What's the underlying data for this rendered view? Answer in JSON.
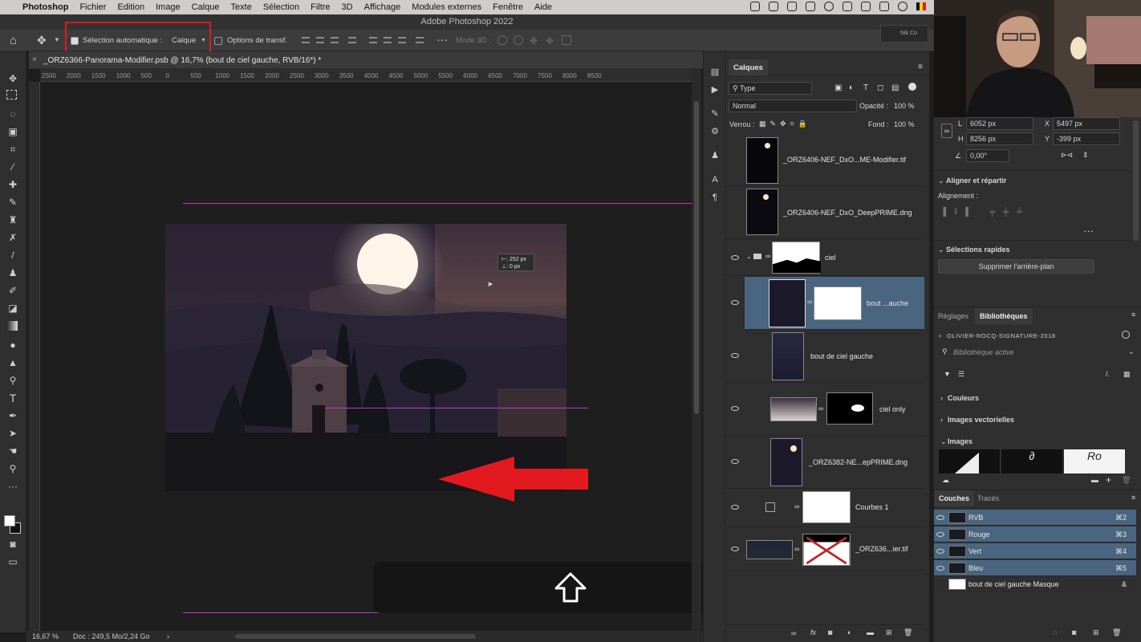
{
  "menubar": {
    "app_name": "Photoshop",
    "items": [
      "Fichier",
      "Edition",
      "Image",
      "Calque",
      "Texte",
      "Sélection",
      "Filtre",
      "3D",
      "Affichage",
      "Modules externes",
      "Fenêtre",
      "Aide"
    ]
  },
  "window": {
    "title": "Adobe Photoshop 2022"
  },
  "options": {
    "auto_select_label": "Sélection automatique :",
    "auto_select_value": "Calque",
    "transform_options_label": "Options de transf.",
    "mode3d_label": "Mode 3D :",
    "nik_label": "Nik Co"
  },
  "document": {
    "tab_title": "_ORZ6366-Panorama-Modifier.psb @ 16,7% (bout de ciel gauche, RVB/16*) *",
    "zoom": "16,67 %",
    "doc_info": "Doc : 249,5 Mo/2,24 Go",
    "ruler_labels": [
      "2500",
      "2000",
      "1500",
      "1000",
      "500",
      "0",
      "500",
      "1000",
      "1500",
      "2000",
      "2500",
      "3000",
      "3500",
      "4000",
      "4500",
      "5000",
      "5500",
      "6000",
      "6500",
      "7000",
      "7500",
      "8000",
      "8500"
    ],
    "move_tooltip": {
      "dx": "252 px",
      "dy": "0 px"
    }
  },
  "layers_panel": {
    "tab": "Calques",
    "filter_kind": "Type",
    "blend_mode": "Normal",
    "opacity_label": "Opacité :",
    "opacity_value": "100 %",
    "lock_label": "Verrou :",
    "fill_label": "Fond :",
    "fill_value": "100 %",
    "layers": [
      {
        "name": "_ORZ6406-NEF_DxO...ME-Modifier.tif",
        "visible": false
      },
      {
        "name": "_ORZ6406-NEF_DxO_DeepPRIME.dng",
        "visible": false
      },
      {
        "name": "ciel",
        "visible": true
      },
      {
        "name": "bout ...auche",
        "visible": true
      },
      {
        "name": "bout de ciel gauche",
        "visible": true
      },
      {
        "name": "ciel only",
        "visible": true
      },
      {
        "name": "_ORZ6382-NE...epPRIME.dng",
        "visible": true
      },
      {
        "name": "Courbes 1",
        "visible": true
      },
      {
        "name": "_ORZ636...ier.tif",
        "visible": true
      }
    ]
  },
  "properties": {
    "w_label": "L",
    "w_value": "6052 px",
    "h_label": "H",
    "h_value": "8256 px",
    "x_label": "X",
    "x_value": "5497 px",
    "y_label": "Y",
    "y_value": "-399 px",
    "angle_value": "0,00°",
    "align_section": "Aligner et répartir",
    "align_label": "Alignement :",
    "quick_section": "Sélections rapides",
    "remove_bg_button": "Supprimer l'arrière-plan"
  },
  "libraries": {
    "tabs": [
      "Réglages",
      "Bibliothèques"
    ],
    "library_name": "OLIVIER-ROCQ-SIGNATURE-2018",
    "search_placeholder": "Bibliothèque active",
    "sections": [
      "Couleurs",
      "Images vectorielles",
      "Images"
    ]
  },
  "channels": {
    "tabs": [
      "Couches",
      "Tracés"
    ],
    "rows": [
      {
        "name": "RVB",
        "shortcut": "⌘2"
      },
      {
        "name": "Rouge",
        "shortcut": "⌘3"
      },
      {
        "name": "Vert",
        "shortcut": "⌘4"
      },
      {
        "name": "Bleu",
        "shortcut": "⌘5"
      },
      {
        "name": "bout de ciel gauche Masque",
        "shortcut": "&"
      }
    ]
  },
  "colors": {
    "accent_red": "#e2191f",
    "guide_magenta": "#c832c8",
    "selection_blue": "#4a6580"
  },
  "icons": [
    "apple-icon",
    "home-icon",
    "move-icon",
    "up-arrow-icon",
    "red-arrow-icon"
  ]
}
